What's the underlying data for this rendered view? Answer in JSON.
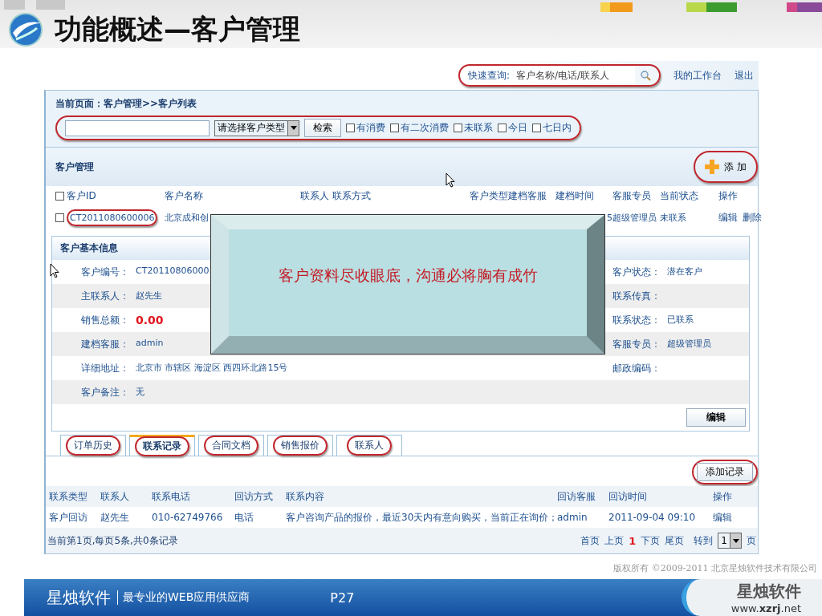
{
  "slide": {
    "title": "功能概述—客户管理",
    "copyright": "版权所有 ©2009-2011 北京星烛软件技术有限公司"
  },
  "footer": {
    "brand": "星烛软件",
    "tagline": "最专业的WEB应用供应商",
    "page": "P27",
    "logo_name": "星烛软件",
    "logo_url": "www.**xzrj**.net"
  },
  "topbar": {
    "quick_search_label": "快速查询:",
    "quick_search_placeholder": "客户名称/电话/联系人",
    "links": [
      "我的工作台",
      "退出"
    ]
  },
  "breadcrumb": "当前页面：客户管理>>客户列表",
  "filter": {
    "type_select": "请选择客户类型",
    "search_button": "检索",
    "checks": [
      {
        "label": "有消费",
        "checked": false
      },
      {
        "label": "有二次消费",
        "checked": false
      },
      {
        "label": "未联系",
        "checked": false
      },
      {
        "label": "今日",
        "checked": false
      },
      {
        "label": "七日内",
        "checked": false
      }
    ]
  },
  "customers": {
    "title": "客户管理",
    "add_button": "添 加",
    "all_checked": false,
    "columns": [
      "客户ID",
      "客户名称",
      "联系人 联系方式",
      "客户类型",
      "建档客服",
      "建档时间",
      "客服专员",
      "当前状态",
      "操作"
    ],
    "rows": [
      {
        "checked": false,
        "id": "CT2011080600006",
        "name": "北京成和创",
        "date_tail": "5",
        "agent": "超级管理员",
        "status": "未联系",
        "actions": [
          "编辑",
          "删除"
        ]
      }
    ]
  },
  "info": {
    "title": "客户基本信息",
    "rows": [
      {
        "left": {
          "label": "客户编号：",
          "value": "CT20110806000"
        },
        "right": {
          "label": "客户状态：",
          "value": "潜在客户"
        }
      },
      {
        "left": {
          "label": "主联系人：",
          "value": "赵先生"
        },
        "right": {
          "label": "联系传真："
        }
      },
      {
        "left": {
          "label": "销售总额：",
          "value": "0.00",
          "kind": "amount"
        },
        "right": {
          "label": "联系状态：",
          "value": "已联系"
        }
      },
      {
        "left": {
          "label": "建档客服：",
          "value": "admin"
        },
        "right": {
          "label": "客服专员：",
          "value": "超级管理员"
        }
      },
      {
        "left": {
          "label": "详细地址：",
          "value": "北京市 市辖区 海淀区 西四环北路15号"
        },
        "right": {
          "label": "邮政编码："
        }
      },
      {
        "left": {
          "label": "客户备注：",
          "value": "无"
        }
      }
    ],
    "edit_button": "编辑"
  },
  "tabs": [
    {
      "label": "订单历史",
      "selected": false
    },
    {
      "label": "联系记录",
      "selected": true
    },
    {
      "label": "合同文档",
      "selected": false
    },
    {
      "label": "销售报价",
      "selected": false
    },
    {
      "label": "联系人",
      "selected": false
    }
  ],
  "records": {
    "add_button": "添加记录",
    "columns": [
      "联系类型",
      "联系人",
      "联系电话",
      "回访方式",
      "联系内容",
      "回访客服",
      "回访时间",
      "操作"
    ],
    "rows": [
      [
        "客户回访",
        "赵先生",
        "010-62749766",
        "电话",
        "客户咨询产品的报价，最近30天内有意向购买，当前正在询价；",
        "admin",
        "2011-09-04 09:10",
        "编辑"
      ]
    ]
  },
  "pager": {
    "summary": "当前第1页,每页5条,共0条记录",
    "links": [
      {
        "label": "首页",
        "selected": false
      },
      {
        "label": "上页",
        "selected": false
      },
      {
        "label": "1",
        "selected": true
      },
      {
        "label": "下页",
        "selected": false
      },
      {
        "label": "尾页",
        "selected": false
      }
    ],
    "goto_label": "转到",
    "goto_value": "1",
    "page_suffix": "页"
  },
  "callout": "客户资料尽收眼底，沟通必将胸有成竹"
}
